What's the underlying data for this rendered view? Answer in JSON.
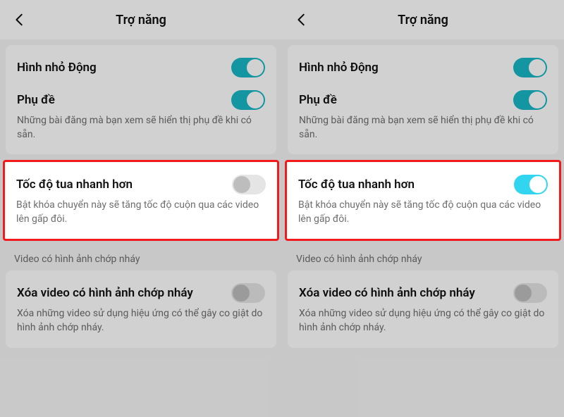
{
  "header": {
    "title": "Trợ năng"
  },
  "settings": {
    "thumbnail": {
      "title": "Hình nhỏ Động",
      "on": true
    },
    "subtitles": {
      "title": "Phụ đề",
      "desc": "Những bài đăng mà bạn xem sẽ hiển thị phụ đề khi có sẵn.",
      "on": true
    },
    "fast_scroll": {
      "title": "Tốc độ tua nhanh hơn",
      "desc": "Bật khóa chuyển này sẽ tăng tốc độ cuộn qua các video lên gấp đôi."
    },
    "flashing_section": "Video có hình ảnh chớp nháy",
    "remove_flashing": {
      "title": "Xóa video có hình ảnh chớp nháy",
      "desc": "Xóa những video sử dụng hiệu ứng có thể gây co giật do hình ảnh chớp nháy.",
      "on": false
    }
  },
  "left_fast_scroll_on": false,
  "right_fast_scroll_on": true
}
